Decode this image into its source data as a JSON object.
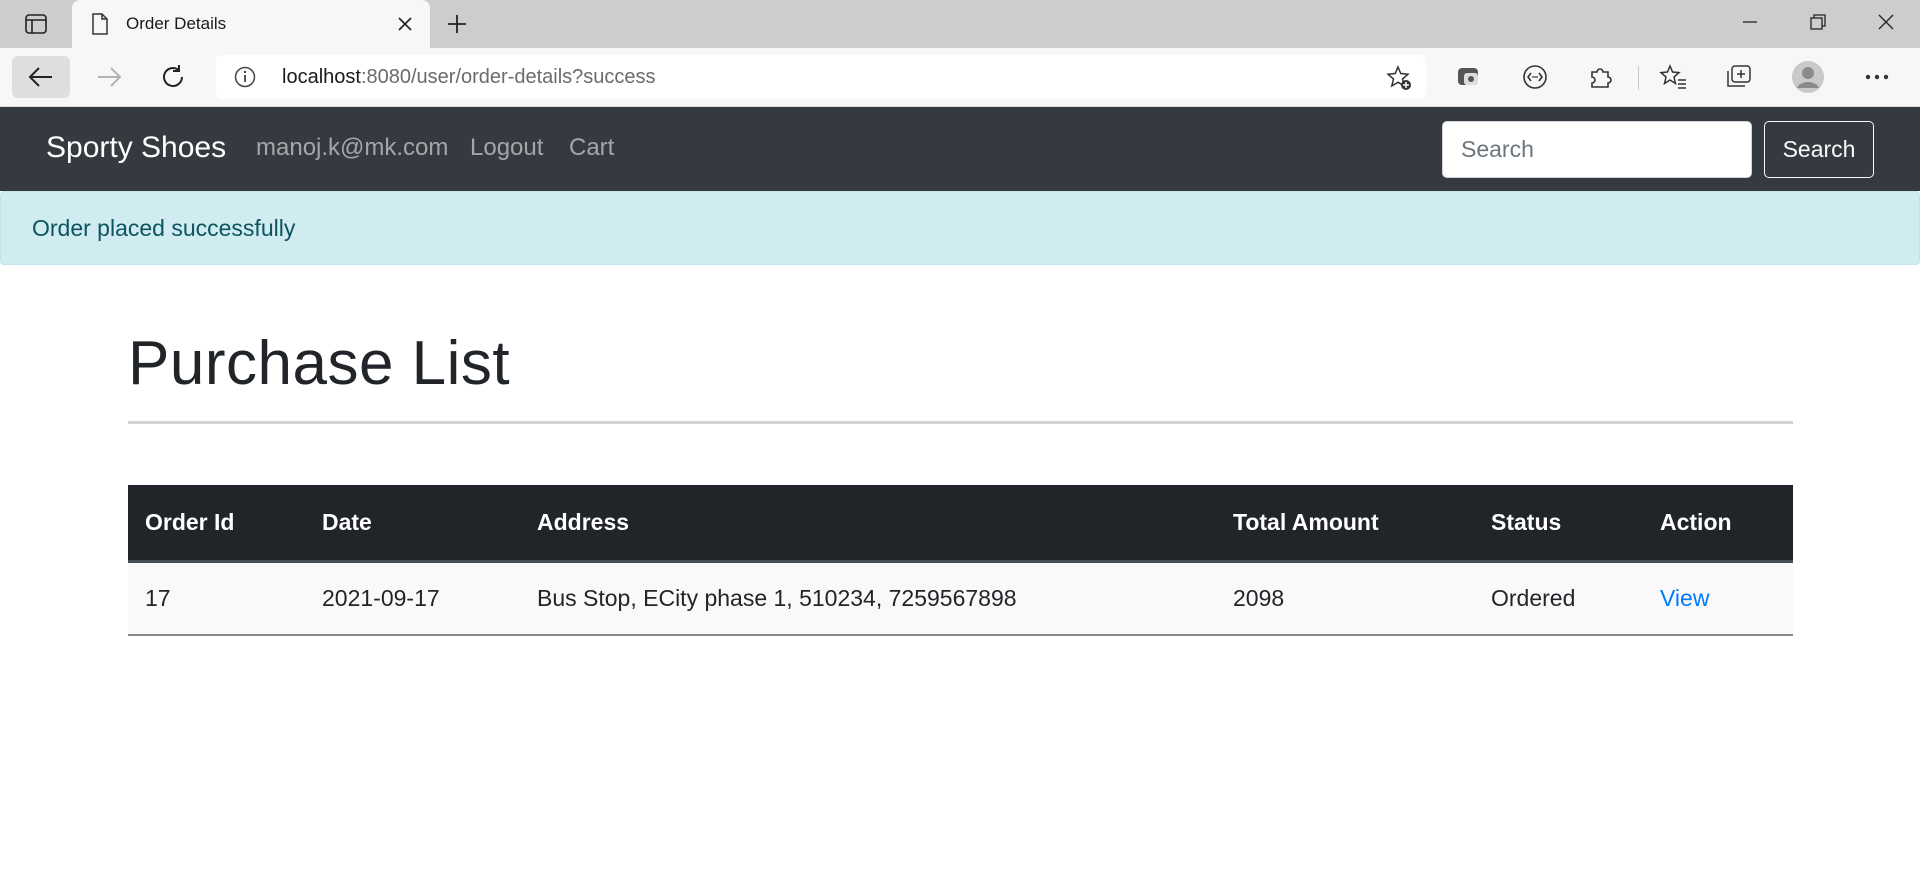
{
  "browser": {
    "tab_title": "Order Details",
    "url_host": "localhost",
    "url_rest": ":8080/user/order-details?success"
  },
  "navbar": {
    "brand": "Sporty Shoes",
    "links": [
      "manoj.k@mk.com",
      "Logout",
      "Cart"
    ],
    "search_placeholder": "Search",
    "search_button": "Search"
  },
  "alert": {
    "message": "Order placed successfully"
  },
  "main": {
    "title": "Purchase List",
    "table": {
      "headers": [
        "Order Id",
        "Date",
        "Address",
        "Total Amount",
        "Status",
        "Action"
      ],
      "rows": [
        {
          "order_id": "17",
          "date": "2021-09-17",
          "address": "Bus Stop, ECity phase 1, 510234, 7259567898",
          "total_amount": "2098",
          "status": "Ordered",
          "action": "View"
        }
      ]
    }
  },
  "colors": {
    "navbar_bg": "#343a40",
    "alert_bg": "#d1ecf1",
    "table_header_bg": "#212529",
    "link": "#007bff"
  }
}
